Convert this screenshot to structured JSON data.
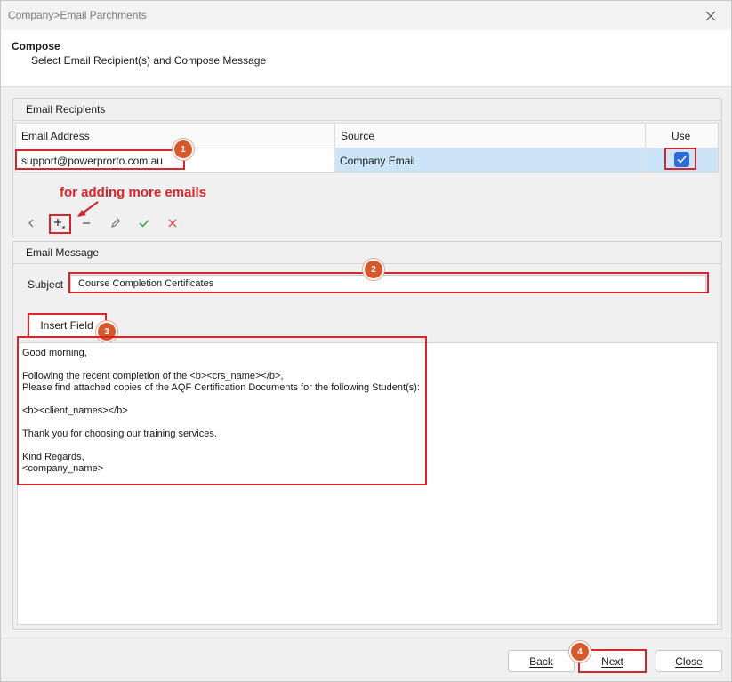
{
  "window": {
    "title": "Company>Email Parchments"
  },
  "header": {
    "title": "Compose",
    "subtitle": "Select Email Recipient(s) and Compose Message"
  },
  "recipients": {
    "group_title": "Email Recipients",
    "columns": [
      "Email Address",
      "Source",
      "Use"
    ],
    "rows": [
      {
        "email": "support@powerprorto.com.au",
        "source": "Company Email",
        "use": true
      }
    ]
  },
  "annotations": {
    "note": "for adding more emails",
    "badges": [
      "1",
      "2",
      "3",
      "4"
    ]
  },
  "toolbar": {
    "icons": [
      "chevron-left-icon",
      "add-icon",
      "remove-icon",
      "edit-icon",
      "confirm-icon",
      "cancel-icon"
    ]
  },
  "message": {
    "group_title": "Email Message",
    "subject_label": "Subject",
    "subject_value": "Course Completion Certificates",
    "insert_field_tab": "Insert Field",
    "body_lines": [
      "Good morning,",
      "",
      "Following the recent completion of the <b><crs_name></b>,",
      "Please find attached copies of the AQF Certification Documents for the following Student(s):",
      "",
      "<b><client_names></b>",
      "",
      "Thank you for choosing our training services.",
      "",
      "Kind Regards,",
      "<company_name>"
    ]
  },
  "footer": {
    "back": "Back",
    "next": "Next",
    "close": "Close"
  },
  "colors": {
    "accent": "#2f6bd8",
    "annotation": "#d6252b",
    "badge": "#d6582b",
    "selected_row": "#cce4f7"
  }
}
